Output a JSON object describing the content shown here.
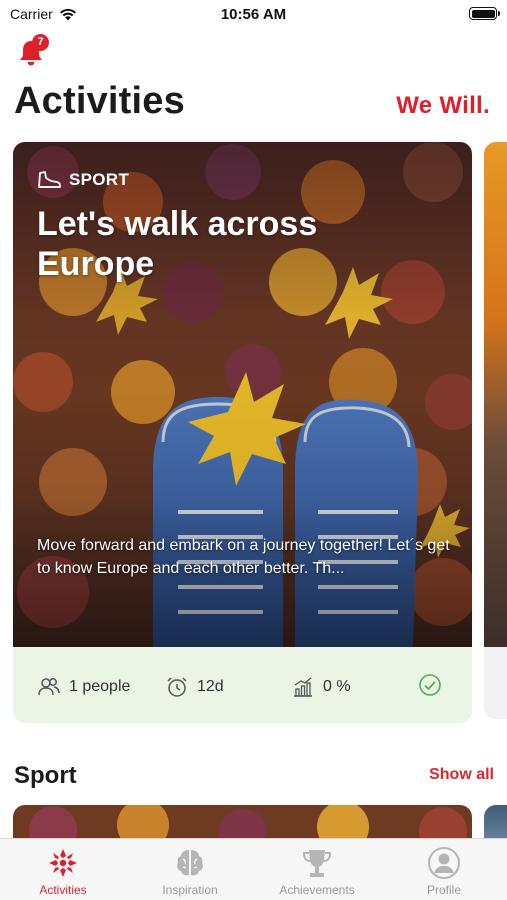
{
  "status_bar": {
    "carrier": "Carrier",
    "time": "10:56 AM"
  },
  "notifications": {
    "count": "7"
  },
  "header": {
    "title": "Activities",
    "brand": "We Will."
  },
  "featured_card": {
    "category": "SPORT",
    "title": "Let's walk across Europe",
    "description": "Move forward and embark on a journey together! Let´s get to know Europe and each other better. Th...",
    "stats": {
      "people": "1 people",
      "duration": "12d",
      "progress": "0 %"
    }
  },
  "section": {
    "title": "Sport",
    "show_all": "Show all"
  },
  "tabs": [
    {
      "label": "Activities",
      "icon": "activities-icon",
      "active": true
    },
    {
      "label": "Inspiration",
      "icon": "brain-icon",
      "active": false
    },
    {
      "label": "Achievements",
      "icon": "trophy-icon",
      "active": false
    },
    {
      "label": "Profile",
      "icon": "profile-icon",
      "active": false
    }
  ],
  "colors": {
    "accent": "#e01f2b",
    "stats_bg": "#eaf5e6",
    "check": "#4caf50"
  }
}
